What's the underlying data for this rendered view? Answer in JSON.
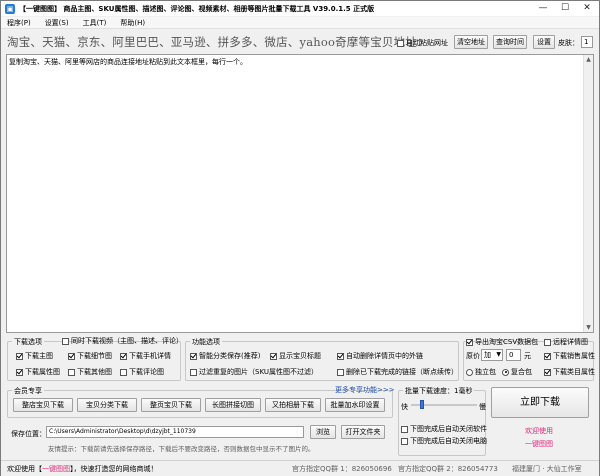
{
  "window": {
    "app_icon": "app-logo-icon",
    "title": "【一键图图】 商品主图、SKU属性图、描述图、评论图、视频素材、相册等图片批量下载工具 V39.0.1.5 正式版",
    "minimize": "—",
    "maximize": "☐",
    "close": "✕"
  },
  "menu": [
    "程序(P)",
    "设置(S)",
    "工具(T)",
    "帮助(H)"
  ],
  "tagline": "淘宝、天猫、京东、阿里巴巴、亚马逊、拼多多、微店、yahoo奇摩等宝贝地址：",
  "top_controls": {
    "auto_paste_label": "自动粘贴网址",
    "auto_paste_checked": false,
    "clear_btn": "清空地址",
    "query_time_btn": "查询时间",
    "settings_btn": "设置",
    "skin_label": "皮肤：",
    "skin_value": "1"
  },
  "textarea": {
    "placeholder": "复制淘宝、天猫、阿里等网店的商品连接地址粘贴到此文本框里，每行一个。"
  },
  "download_options": {
    "title": "下载选项",
    "sync_video_label": "同时下载视频（主图、描述、评论）",
    "sync_video_checked": false,
    "items": [
      {
        "label": "下载主图",
        "checked": true
      },
      {
        "label": "下载细节图",
        "checked": true
      },
      {
        "label": "下载手机详情",
        "checked": true
      },
      {
        "label": "下载属性图",
        "checked": true
      },
      {
        "label": "下载其他图",
        "checked": false
      },
      {
        "label": "下载评论图",
        "checked": false
      }
    ]
  },
  "function_options": {
    "title": "功能选项",
    "items": [
      {
        "label": "智能分类保存(推荐)",
        "checked": true
      },
      {
        "label": "显示宝贝标题",
        "checked": true
      },
      {
        "label": "自动删除详情页中的外链",
        "checked": true
      },
      {
        "label": "过滤重复的图片（SKU属性图不过滤）",
        "checked": false
      },
      {
        "label": "删除已下载完成的链接（断点续传）",
        "checked": false
      }
    ]
  },
  "right_options": {
    "export_csv": {
      "label": "导出淘宝CSV数据包",
      "checked": true
    },
    "long_detail": {
      "label": "远程详情图",
      "checked": false
    },
    "original_price_label": "原价",
    "op_value": "加",
    "amount_value": "0",
    "unit": "元",
    "download_sales_attr": {
      "label": "下载销售属性",
      "checked": true
    },
    "independent_pkg": {
      "label": "独立包",
      "checked": false
    },
    "composite_pkg": {
      "label": "复合包",
      "checked": true
    },
    "download_category_attr": {
      "label": "下载类目属性",
      "checked": true
    }
  },
  "member": {
    "title": "会员专享",
    "more_link": "更多专享功能>>>",
    "buttons": [
      "整店宝贝下载",
      "宝贝分类下载",
      "整页宝贝下载",
      "长图拼接切图",
      "又拍相册下载",
      "批量加水印设置"
    ]
  },
  "speed": {
    "title": "批量下载速度：1毫秒",
    "fast": "快",
    "slow": "慢",
    "level": 0.15,
    "after_done_close": {
      "label": "下图完成后自动关闭软件",
      "checked": false
    },
    "after_done_shutdown": {
      "label": "下图完成后自动关闭电脑",
      "checked": false
    }
  },
  "save": {
    "label": "保存位置：",
    "path": "C:\\Users\\Administrator\\Desktop\\d\\dzyjbt_110739",
    "browse_btn": "浏览",
    "open_btn": "打开文件夹",
    "hint": "友情提示：下载前请先选择保存路径，下载后不要改变路径，否则数据包中显示不了图片的。"
  },
  "download_btn": "立即下载",
  "welcome": "欢迎使用",
  "brand": "一键图图",
  "colors": {
    "accent_pink": "#e0297a",
    "accent_blue": "#1f4fb4"
  },
  "statusbar": {
    "welcome_prefix": "欢迎使用【",
    "brand_name": "一键图图",
    "welcome_suffix": "】，快速打造您的网络商城！",
    "qq1": "官方指定QQ群 1：826050696",
    "qq2": "官方指定QQ群 2：826054773",
    "company": "福建厦门 · 大仙工作室"
  }
}
